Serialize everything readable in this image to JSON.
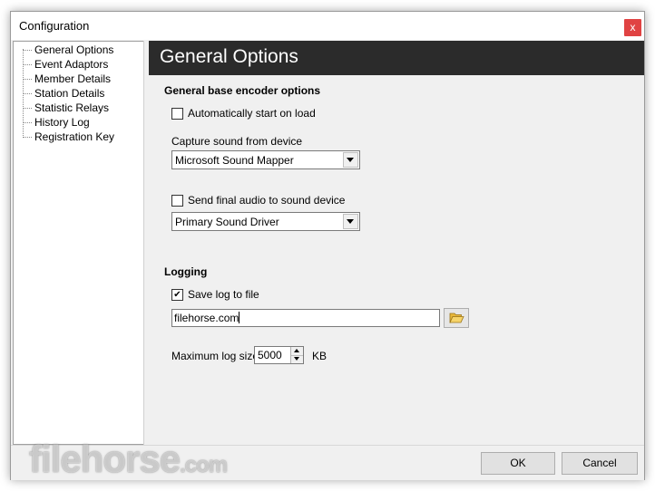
{
  "window": {
    "title": "Configuration",
    "close_label": "x"
  },
  "tree": {
    "items": [
      {
        "label": "General Options"
      },
      {
        "label": "Event Adaptors"
      },
      {
        "label": "Member Details"
      },
      {
        "label": "Station Details"
      },
      {
        "label": "Statistic Relays"
      },
      {
        "label": "History Log"
      },
      {
        "label": "Registration Key"
      }
    ]
  },
  "panel": {
    "title": "General Options",
    "encoder": {
      "section_title": "General base encoder options",
      "auto_start": {
        "label": "Automatically start on load",
        "checked": false
      },
      "capture_label": "Capture sound from device",
      "capture_device": "Microsoft Sound Mapper",
      "send_final": {
        "label": "Send final audio to sound device",
        "checked": false
      },
      "output_device": "Primary Sound Driver"
    },
    "logging": {
      "section_title": "Logging",
      "save_log": {
        "label": "Save log to file",
        "checked": true,
        "mark": "✔"
      },
      "log_file": "filehorse.com",
      "max_size_label": "Maximum log size",
      "max_size_value": "5000",
      "max_size_unit": "KB"
    }
  },
  "buttons": {
    "ok": "OK",
    "cancel": "Cancel"
  },
  "watermark": {
    "text": "filehorse",
    "suffix": ".com"
  }
}
